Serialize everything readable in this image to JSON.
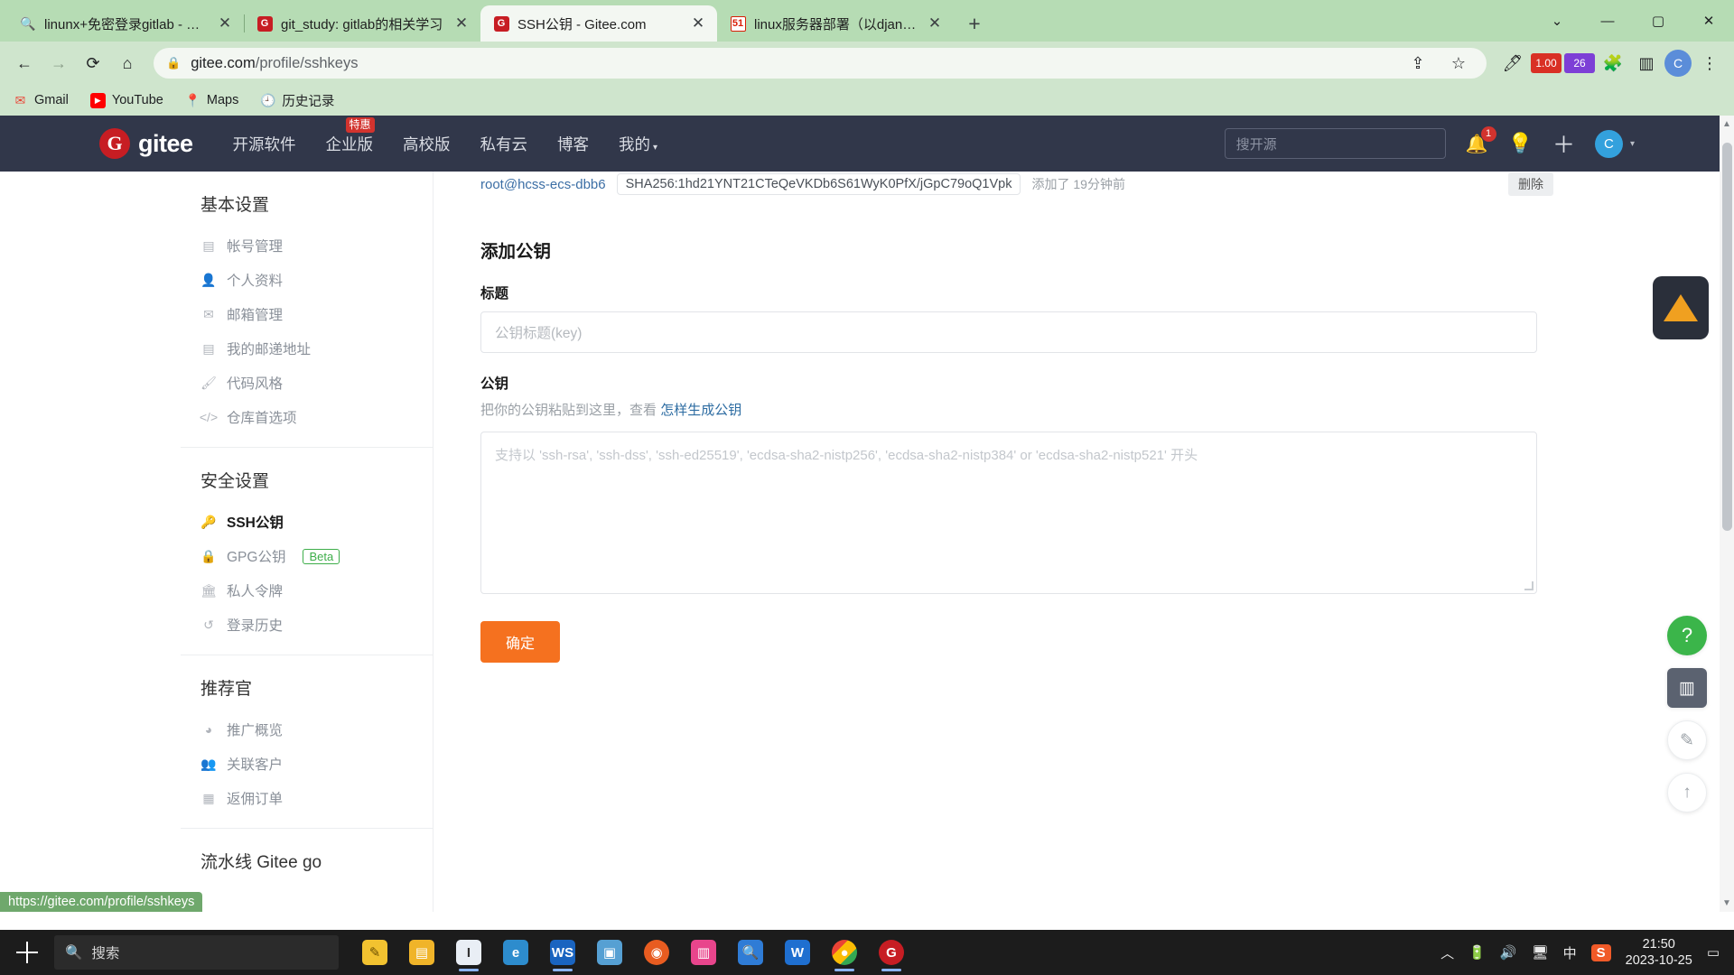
{
  "browser": {
    "tabs": [
      {
        "title": "linunx+免密登录gitlab - 搜索",
        "favicon": "search-icon",
        "active": false
      },
      {
        "title": "git_study: gitlab的相关学习",
        "favicon": "gitee-icon",
        "active": false
      },
      {
        "title": "SSH公钥 - Gitee.com",
        "favicon": "gitee-icon",
        "active": true
      },
      {
        "title": "linux服务器部署（以django项",
        "favicon": "51cto-icon",
        "active": false
      }
    ],
    "new_tab_label": "+",
    "window_controls": {
      "minimize": "—",
      "maximize": "▢",
      "close": "✕",
      "expand": "⌄"
    },
    "toolbar": {
      "back": "←",
      "forward": "→",
      "reload": "⟳",
      "home": "⌂",
      "url_host": "gitee.com",
      "url_path": "/profile/sshkeys",
      "lock_icon": "lock-icon",
      "share_icon": "share-icon",
      "star_icon": "star-icon",
      "ext_badge_1": "1.00",
      "ext_badge_2": "26",
      "puzzle_icon": "extensions-icon",
      "sidepanel_icon": "side-panel-icon",
      "profile_icon": "profile-icon",
      "menu_icon": "⋮"
    },
    "bookmarks": [
      {
        "label": "Gmail",
        "icon": "gmail-icon"
      },
      {
        "label": "YouTube",
        "icon": "youtube-icon"
      },
      {
        "label": "Maps",
        "icon": "maps-icon"
      },
      {
        "label": "历史记录",
        "icon": "history-icon"
      }
    ],
    "status_url": "https://gitee.com/profile/sshkeys"
  },
  "gitee": {
    "logo_text": "gitee",
    "logo_mark": "G",
    "nav": [
      {
        "label": "开源软件",
        "badge": null
      },
      {
        "label": "企业版",
        "badge": "特惠"
      },
      {
        "label": "高校版",
        "badge": null
      },
      {
        "label": "私有云",
        "badge": null
      },
      {
        "label": "博客",
        "badge": null
      },
      {
        "label": "我的",
        "badge": null,
        "caret": true
      }
    ],
    "search_placeholder": "搜开源",
    "notification_count": "1",
    "avatar_letter": "C"
  },
  "sidebar": {
    "groups": [
      {
        "title": "基本设置",
        "items": [
          {
            "label": "帐号管理",
            "icon": "id-card-icon",
            "active": false
          },
          {
            "label": "个人资料",
            "icon": "user-icon",
            "active": false
          },
          {
            "label": "邮箱管理",
            "icon": "envelope-icon",
            "active": false
          },
          {
            "label": "我的邮递地址",
            "icon": "id-card-icon",
            "active": false
          },
          {
            "label": "代码风格",
            "icon": "brush-icon",
            "active": false
          },
          {
            "label": "仓库首选项",
            "icon": "code-icon",
            "active": false
          }
        ]
      },
      {
        "title": "安全设置",
        "items": [
          {
            "label": "SSH公钥",
            "icon": "key-icon",
            "active": true
          },
          {
            "label": "GPG公钥",
            "icon": "lock-icon",
            "active": false,
            "tag": "Beta"
          },
          {
            "label": "私人令牌",
            "icon": "token-icon",
            "active": false
          },
          {
            "label": "登录历史",
            "icon": "history-icon",
            "active": false
          }
        ]
      },
      {
        "title": "推荐官",
        "items": [
          {
            "label": "推广概览",
            "icon": "megaphone-icon",
            "active": false
          },
          {
            "label": "关联客户",
            "icon": "user-link-icon",
            "active": false
          },
          {
            "label": "返佣订单",
            "icon": "receipt-icon",
            "active": false
          }
        ]
      },
      {
        "title": "流水线 Gitee go",
        "items": []
      }
    ]
  },
  "main": {
    "existing_key": {
      "user": "root@hcss-ecs-dbb6",
      "fingerprint": "SHA256:1hd21YNT21CTeQeVKDb6S61WyK0PfX/jGpC79oQ1Vpk",
      "meta": "添加了 19分钟前",
      "delete_label": "删除"
    },
    "form_title": "添加公钥",
    "title_label": "标题",
    "title_placeholder": "公钥标题(key)",
    "title_value": "",
    "key_label": "公钥",
    "key_help_text": "把你的公钥粘贴到这里，查看",
    "key_help_link": "怎样生成公钥",
    "key_placeholder": "支持以 'ssh-rsa', 'ssh-dss', 'ssh-ed25519', 'ecdsa-sha2-nistp256', 'ecdsa-sha2-nistp384' or 'ecdsa-sha2-nistp521' 开头",
    "key_value": "",
    "submit_label": "确定"
  },
  "floating": {
    "help_label": "?",
    "kiwi_icon": "kiwi-icon",
    "calc_icon": "calculator-icon",
    "feedback_icon": "feedback-icon",
    "top_icon": "scroll-top-icon"
  },
  "taskbar": {
    "start_icon": "windows-start-icon",
    "search_placeholder": "搜索",
    "search_icon": "search-icon",
    "apps": [
      {
        "icon": "files-icon",
        "name": "file-explorer",
        "label": ""
      },
      {
        "icon": "text-icon",
        "name": "notepad",
        "label": "I"
      },
      {
        "icon": "browser-icon",
        "name": "edge",
        "label": ""
      },
      {
        "icon": "ws-icon",
        "name": "wps-writer",
        "label": "WS"
      },
      {
        "icon": "image-icon",
        "name": "photos",
        "label": ""
      },
      {
        "icon": "firefox-icon",
        "name": "firefox",
        "label": ""
      },
      {
        "icon": "pink-icon",
        "name": "app-pink",
        "label": ""
      },
      {
        "icon": "search-app-icon",
        "name": "everything",
        "label": ""
      },
      {
        "icon": "w-icon",
        "name": "wechat-work",
        "label": "W"
      },
      {
        "icon": "chrome-icon",
        "name": "chrome",
        "label": ""
      },
      {
        "icon": "gitee-app-icon",
        "name": "gitee-app",
        "label": ""
      }
    ],
    "tray": {
      "chevron": "︿",
      "battery": "battery-icon",
      "volume": "volume-icon",
      "network": "network-icon",
      "ime": "中",
      "sogou": "S",
      "time": "21:50",
      "date": "2023-10-25",
      "notifications": "notification-icon"
    }
  }
}
